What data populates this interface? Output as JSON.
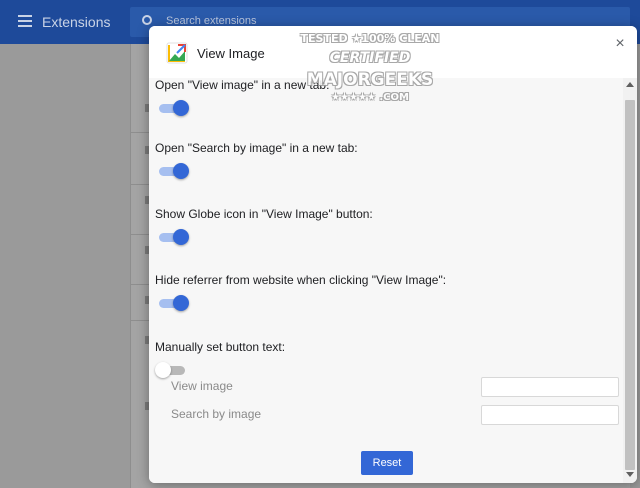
{
  "background": {
    "topbar_title": "Extensions",
    "search_placeholder": "Search extensions"
  },
  "dialog": {
    "title": "View Image",
    "close_glyph": "×",
    "options": [
      {
        "label": "Open \"View image\" in a new tab:",
        "enabled": true
      },
      {
        "label": "Open \"Search by image\" in a new tab:",
        "enabled": true
      },
      {
        "label": "Show Globe icon in \"View Image\" button:",
        "enabled": true
      },
      {
        "label": "Hide referrer from website when clicking \"View Image\":",
        "enabled": true
      },
      {
        "label": "Manually set button text:",
        "enabled": false
      }
    ],
    "fields": [
      {
        "label": "View image",
        "value": ""
      },
      {
        "label": "Search by image",
        "value": ""
      }
    ],
    "reset_label": "Reset"
  },
  "watermark": {
    "line1": "TESTED ★100% CLEAN",
    "line2": "CERTIFIED",
    "line3": "MAJORGEEKS",
    "line4": "★★★★★ .COM"
  },
  "colors": {
    "accent": "#3367d6",
    "header_bar": "#1e4a9a"
  }
}
